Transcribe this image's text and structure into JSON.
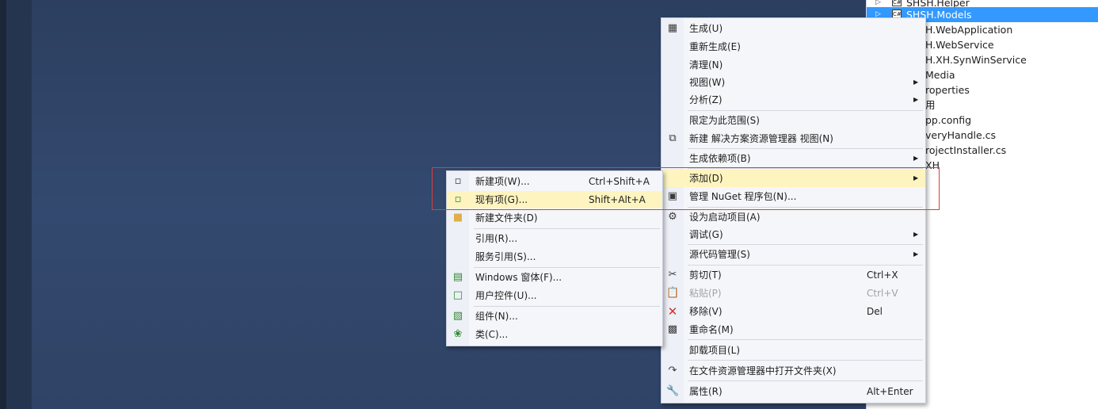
{
  "solution_explorer": {
    "items": [
      {
        "label": "SHSH.Helper",
        "expandable": true,
        "selected": false
      },
      {
        "label": "SHSH.Models",
        "expandable": true,
        "selected": true
      },
      {
        "label": "H.WebApplication",
        "expandable": false,
        "selected": false
      },
      {
        "label": "H.WebService",
        "expandable": false,
        "selected": false
      },
      {
        "label": "H.XH.SynWinService",
        "expandable": false,
        "selected": false
      },
      {
        "label": "Media",
        "expandable": false,
        "selected": false
      },
      {
        "label": "roperties",
        "expandable": false,
        "selected": false
      },
      {
        "label": "用",
        "expandable": false,
        "selected": false
      },
      {
        "label": "pp.config",
        "expandable": false,
        "selected": false
      },
      {
        "label": "veryHandle.cs",
        "expandable": false,
        "selected": false
      },
      {
        "label": "rojectInstaller.cs",
        "expandable": false,
        "selected": false
      },
      {
        "label": "XH",
        "expandable": false,
        "selected": false
      }
    ]
  },
  "context_menu": {
    "items": [
      {
        "label": "生成(U)",
        "icon": "build-icon"
      },
      {
        "label": "重新生成(E)"
      },
      {
        "label": "清理(N)"
      },
      {
        "label": "视图(W)",
        "submenu": true
      },
      {
        "label": "分析(Z)",
        "submenu": true
      },
      {
        "label": "限定为此范围(S)"
      },
      {
        "label": "新建 解决方案资源管理器 视图(N)",
        "icon": "new-view-icon"
      },
      {
        "label": "生成依赖项(B)",
        "submenu": true
      },
      {
        "label": "添加(D)",
        "submenu": true,
        "highlighted": true
      },
      {
        "label": "管理 NuGet 程序包(N)...",
        "icon": "nuget-icon"
      },
      {
        "label": "设为启动项目(A)",
        "icon": "gear-icon"
      },
      {
        "label": "调试(G)",
        "submenu": true
      },
      {
        "label": "源代码管理(S)",
        "submenu": true
      },
      {
        "label": "剪切(T)",
        "shortcut": "Ctrl+X",
        "icon": "scissors-icon"
      },
      {
        "label": "粘贴(P)",
        "shortcut": "Ctrl+V",
        "icon": "paste-icon",
        "disabled": true
      },
      {
        "label": "移除(V)",
        "shortcut": "Del",
        "icon": "remove-icon"
      },
      {
        "label": "重命名(M)",
        "icon": "rename-icon"
      },
      {
        "label": "卸载项目(L)"
      },
      {
        "label": "在文件资源管理器中打开文件夹(X)",
        "icon": "open-folder-arrow-icon"
      },
      {
        "label": "属性(R)",
        "shortcut": "Alt+Enter",
        "icon": "wrench-icon"
      }
    ]
  },
  "add_submenu": {
    "items": [
      {
        "label": "新建项(W)...",
        "shortcut": "Ctrl+Shift+A",
        "icon": "new-item-icon"
      },
      {
        "label": "现有项(G)...",
        "shortcut": "Shift+Alt+A",
        "icon": "existing-item-icon",
        "highlighted": true
      },
      {
        "label": "新建文件夹(D)",
        "icon": "new-folder-icon"
      },
      {
        "label": "引用(R)..."
      },
      {
        "label": "服务引用(S)..."
      },
      {
        "label": "Windows 窗体(F)...",
        "icon": "windows-form-icon"
      },
      {
        "label": "用户控件(U)...",
        "icon": "user-control-icon"
      },
      {
        "label": "组件(N)...",
        "icon": "component-icon"
      },
      {
        "label": "类(C)...",
        "icon": "class-icon"
      }
    ]
  },
  "colors": {
    "selection": "#3399ff",
    "menu_highlight": "#fdf4bf",
    "annotation_box": "#e03c3c",
    "editor_background": "#2f4468"
  }
}
